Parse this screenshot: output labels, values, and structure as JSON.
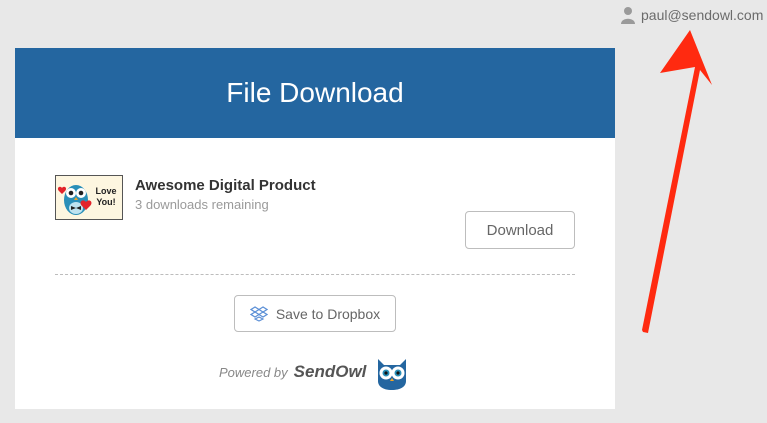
{
  "user": {
    "email": "paul@sendowl.com",
    "icon": "user-icon"
  },
  "card": {
    "title": "File Download",
    "product": {
      "name": "Awesome Digital Product",
      "remaining": "3 downloads remaining",
      "thumbnail_text": "Love You!"
    },
    "download_label": "Download",
    "dropbox_label": "Save to Dropbox",
    "powered_by": "Powered by",
    "brand": "SendOwl"
  },
  "colors": {
    "header": "#2466a0",
    "annotation_arrow": "#ff2a10"
  }
}
